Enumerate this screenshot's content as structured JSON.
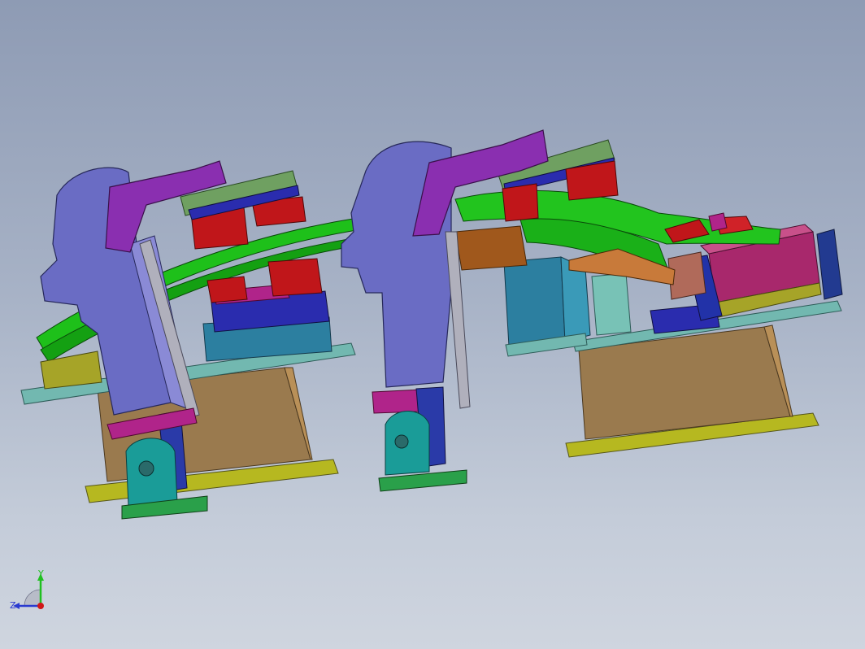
{
  "viewport": {
    "description_colors": {
      "background_top": "#8e9bb4",
      "background_bottom": "#cfd5df",
      "clamp_arm": "#6a6cc4",
      "clamp_head": "#8a2fb0",
      "bracket": "#6fa061",
      "red_block": "#c0161a",
      "rail": "#1ec01a",
      "base_plate": "#72b8b0",
      "support_block": "#9a7a4e",
      "floor_plate": "#b6b820",
      "cylinder": "#1a9c98",
      "blue_block": "#2a2cae"
    }
  },
  "triad": {
    "x_label": "",
    "y_label": "Y",
    "z_label": "Z",
    "icon": "coordinate-triad-icon"
  }
}
